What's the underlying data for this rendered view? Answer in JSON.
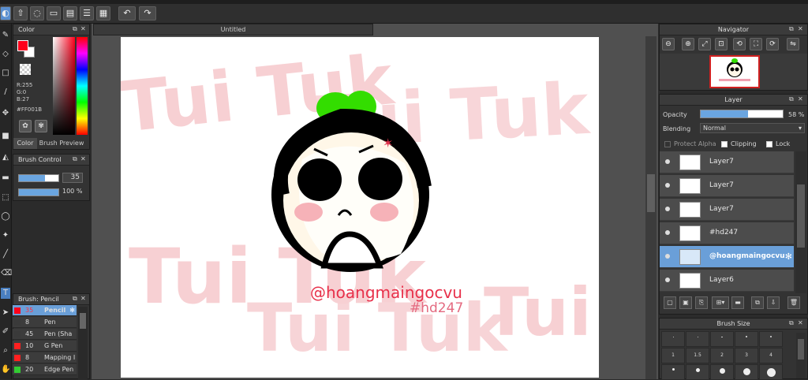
{
  "toolbar": {
    "buttons": [
      "palette-icon",
      "export-icon",
      "comment-icon",
      "message-icon",
      "document-icon",
      "list-icon",
      "grid-icon",
      "undo-icon",
      "redo-icon"
    ]
  },
  "color_panel": {
    "title": "Color",
    "r": "R:255",
    "g": "G:0",
    "b": "B:27",
    "hex": "#FF001B",
    "tab_color": "Color",
    "tab_brush_preview": "Brush Preview",
    "main_color": "#FF001B"
  },
  "brush_control": {
    "title": "Brush Control",
    "size_value": "35",
    "opacity_value": "100 %"
  },
  "brush_list": {
    "title": "Brush: Pencil",
    "items": [
      {
        "color": "#ff001b",
        "size": "35",
        "name": "Pencil",
        "selected": true
      },
      {
        "color": "#3a3a3a",
        "size": "8",
        "name": "Pen",
        "selected": false
      },
      {
        "color": "#3a3a3a",
        "size": "45",
        "name": "Pen (Sha",
        "selected": false
      },
      {
        "color": "#ff2020",
        "size": "10",
        "name": "G Pen",
        "selected": false
      },
      {
        "color": "#ff2020",
        "size": "8",
        "name": "Mapping I",
        "selected": false
      },
      {
        "color": "#33cc33",
        "size": "20",
        "name": "Edge Pen",
        "selected": false
      }
    ]
  },
  "document": {
    "tab_title": "Untitled",
    "watermark_text": "Tui Tuk",
    "watermark_small": "Tui",
    "signature": "@hoangmaingocvu",
    "hashtag": "#hd247"
  },
  "navigator": {
    "title": "Navigator"
  },
  "layer_panel": {
    "title": "Layer",
    "opacity_label": "Opacity",
    "opacity_value": "58 %",
    "opacity_fraction": 0.58,
    "blending_label": "Blending",
    "blending_value": "Normal",
    "protect_alpha": "Protect Alpha",
    "clipping": "Clipping",
    "lock": "Lock",
    "layers": [
      {
        "name": "Layer7",
        "selected": false
      },
      {
        "name": "Layer7",
        "selected": false
      },
      {
        "name": "Layer7",
        "selected": false
      },
      {
        "name": "#hd247",
        "selected": false
      },
      {
        "name": "@hoangmaingocvu",
        "selected": true
      },
      {
        "name": "Layer6",
        "selected": false
      }
    ]
  },
  "brush_size": {
    "title": "Brush Size",
    "row1": [
      "1",
      "1.5",
      "2",
      "3",
      "4"
    ]
  }
}
